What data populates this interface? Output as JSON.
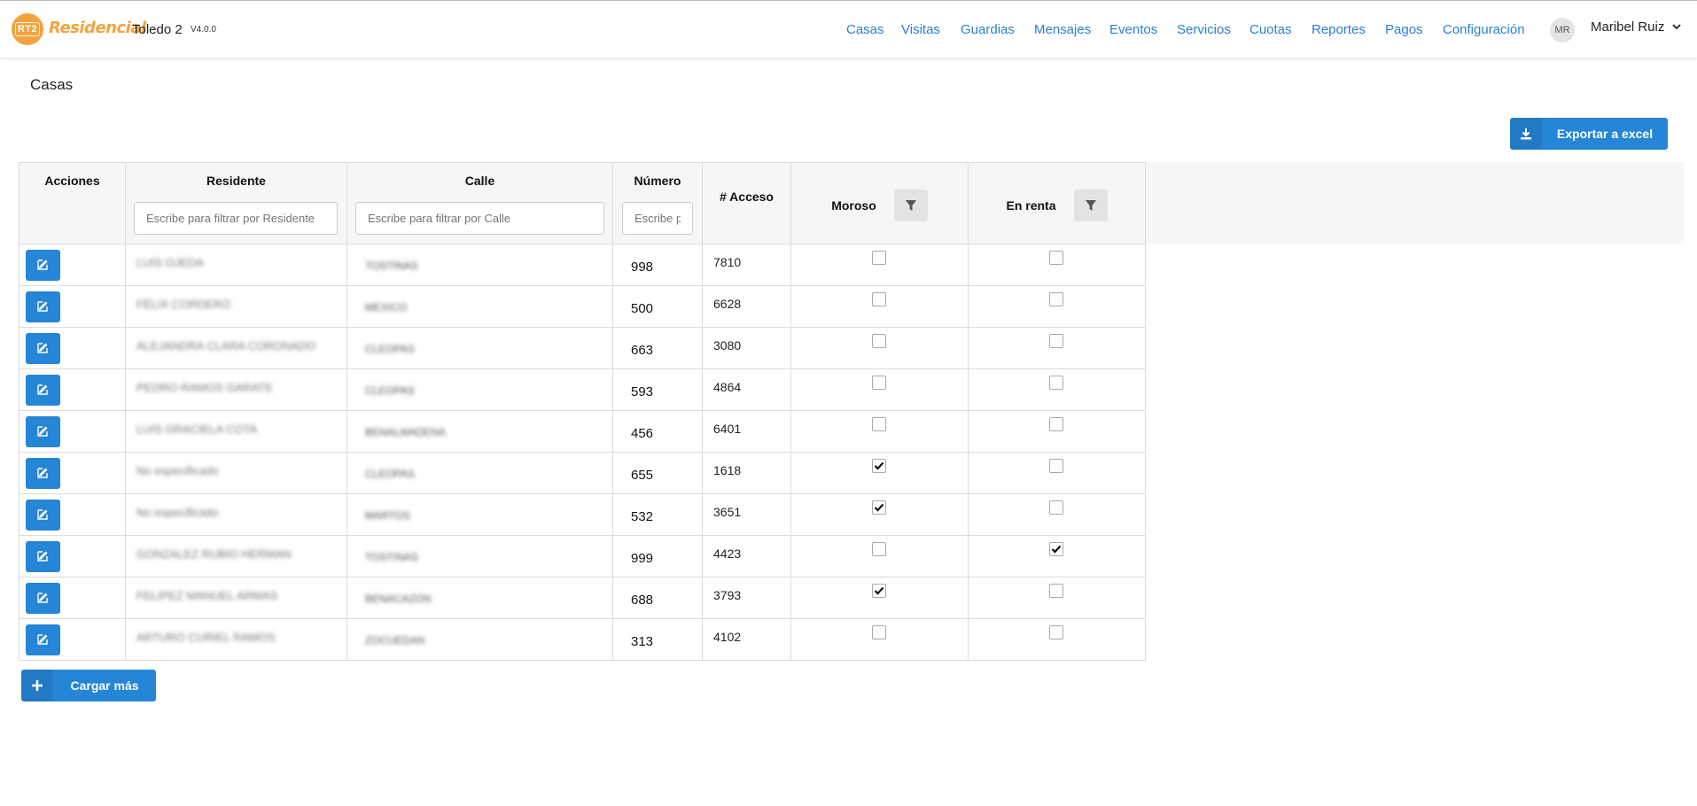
{
  "app": {
    "logo_text": "RT2",
    "brand": "Residencial",
    "subtitle": "Toledo 2",
    "version": "V4.0.0"
  },
  "nav": {
    "items": [
      "Casas",
      "Visitas",
      "Guardias",
      "Mensajes",
      "Eventos",
      "Servicios",
      "Cuotas",
      "Reportes",
      "Pagos",
      "Configuración"
    ]
  },
  "user": {
    "initials": "MR",
    "name": "Maribel Ruiz"
  },
  "page": {
    "title": "Casas"
  },
  "actions": {
    "export_label": "Exportar a excel",
    "load_more_label": "Cargar más"
  },
  "table": {
    "columns": {
      "acciones": "Acciones",
      "residente": "Residente",
      "calle": "Calle",
      "numero": "Número",
      "acceso": "# Acceso",
      "moroso": "Moroso",
      "renta": "En renta"
    },
    "filters": {
      "residente_placeholder": "Escribe para filtrar por Residente",
      "calle_placeholder": "Escribe para filtrar por Calle",
      "numero_placeholder": "Escribe para filtrar por Número"
    },
    "rows": [
      {
        "residente": "LUIS OJEDA",
        "calle": "TOSTINAS",
        "numero": "998",
        "acceso": "7810",
        "moroso": false,
        "renta": false
      },
      {
        "residente": "FÉLIX CORDERO",
        "calle": "MEXICO",
        "numero": "500",
        "acceso": "6628",
        "moroso": false,
        "renta": false
      },
      {
        "residente": "ALEJANDRA CLARA CORONADO",
        "calle": "CLEOPAS",
        "numero": "663",
        "acceso": "3080",
        "moroso": false,
        "renta": false
      },
      {
        "residente": "PEDRO RAMOS GARATE",
        "calle": "CLEOPAS",
        "numero": "593",
        "acceso": "4864",
        "moroso": false,
        "renta": false
      },
      {
        "residente": "LUIS GRACIELA COTA",
        "calle": "BENALMADENA",
        "numero": "456",
        "acceso": "6401",
        "moroso": false,
        "renta": false
      },
      {
        "residente": "No especificado",
        "calle": "CLEOPAS",
        "numero": "655",
        "acceso": "1618",
        "moroso": true,
        "renta": false
      },
      {
        "residente": "No especificado",
        "calle": "MARTOS",
        "numero": "532",
        "acceso": "3651",
        "moroso": true,
        "renta": false
      },
      {
        "residente": "GONZALEZ RUBIO HERMAN",
        "calle": "TOSTINAS",
        "numero": "999",
        "acceso": "4423",
        "moroso": false,
        "renta": true
      },
      {
        "residente": "FELIPEZ MANUEL ARMAS",
        "calle": "BENACAZON",
        "numero": "688",
        "acceso": "3793",
        "moroso": true,
        "renta": false
      },
      {
        "residente": "ARTURO CURIEL RAMOS",
        "calle": "ZOCUEDAN",
        "numero": "313",
        "acceso": "4102",
        "moroso": false,
        "renta": false
      }
    ]
  },
  "colors": {
    "accent": "#2585d6",
    "brand": "#f7a23c",
    "nav_link": "#2a7fd4"
  },
  "icons": {
    "edit": "edit-icon",
    "filter": "filter-icon",
    "download": "download-icon",
    "plus": "plus-icon",
    "chevron": "chevron-down-icon"
  }
}
